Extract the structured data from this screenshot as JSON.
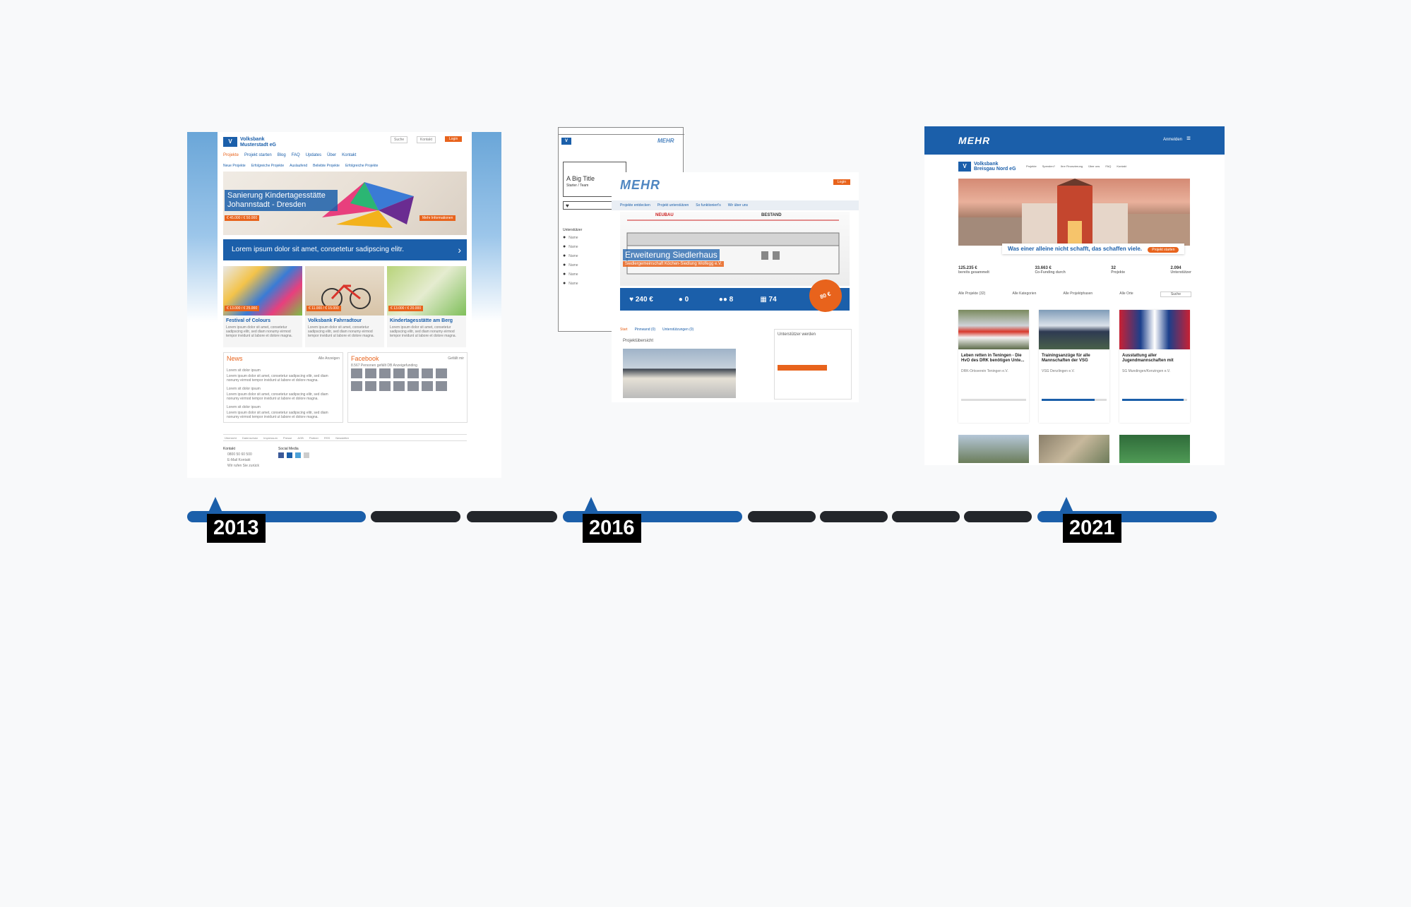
{
  "timeline": {
    "years": [
      "2013",
      "2016",
      "2021"
    ]
  },
  "shot2013": {
    "bank_name": "Volksbank",
    "bank_sub": "Musterstadt eG",
    "top_buttons": [
      "Suche",
      "Kontakt",
      "Login"
    ],
    "nav": [
      "Projekte",
      "Projekt starten",
      "Blog",
      "FAQ",
      "Updates",
      "Über",
      "Kontakt"
    ],
    "subnav": [
      "Neue Projekte",
      "Erfolgreiche Projekte",
      "Auslaufend",
      "Beliebte Projekte",
      "Erfolgreiche Projekte"
    ],
    "hero_title": "Sanierung Kindertagesstätte Johannstadt - Dresden",
    "hero_price": "€ 45.000 / € 50.000",
    "hero_btn": "Mehr Informationen",
    "banner": "Lorem ipsum dolor sit amet, consetetur sadipscing elitr.",
    "cards": [
      {
        "price": "€ 13.000 / € 25.000",
        "title": "Festival of Colours"
      },
      {
        "price": "€ 11.000 / € 15.000",
        "title": "Volksbank Fahrradtour"
      },
      {
        "price": "€ 13.000 / € 20.000",
        "title": "Kindertagesstätte am Berg"
      }
    ],
    "card_desc": "Lorem ipsum dolor sit amet, consetetur sadipscing elitr, sed diam nonumy eirmod tempor invidunt ut labore et dolore magna.",
    "news_title": "News",
    "news_link": "Alle Anzeigen",
    "news_items": [
      "Lorem sit dolor ipsum",
      "Lorem sit dolor ipsum",
      "Lorem sit dolor ipsum"
    ],
    "fb_title": "Facebook",
    "fb_like": "Gefällt mir",
    "fb_text": "8.567 Personen gefällt DB Anzeigefunding",
    "footer": [
      "Übersicht",
      "Datenschutz",
      "Impressum",
      "Presse",
      "AGB",
      "Partner",
      "RSS",
      "Newsletter"
    ],
    "contact_title": "Kontakt",
    "contact_items": [
      "0800 50 60 500",
      "E-Mail Kontakt",
      "Wir rufen Sie zurück"
    ],
    "social_title": "Social Media"
  },
  "shot2016": {
    "wire_title": "A Big Title",
    "wire_sub": "Starter / Team",
    "wire_support": "Unterstützer",
    "wire_name": "Name",
    "logo": "MEHR",
    "login": "Login",
    "nav": [
      "Projekte entdecken",
      "Projekt unterstützen",
      "So funktioniert's",
      "Wir über uns"
    ],
    "neubau": "NEUBAU",
    "bestand": "BESTAND",
    "title": "Erweiterung Siedlerhaus",
    "subtitle": "Siedlergemeinschaft Köchen-Siedlung Wolfegg e.V.",
    "stats": [
      {
        "icon": "heart",
        "value": "240 €"
      },
      {
        "icon": "user",
        "value": "0"
      },
      {
        "icon": "users",
        "value": "8"
      },
      {
        "icon": "calendar",
        "value": "74"
      }
    ],
    "stamp": "80 €",
    "tabs": [
      "Start",
      "Pinnwand (0)",
      "Unterstützungen (0)"
    ],
    "overview": "Projektübersicht",
    "support_title": "Unterstützer werden"
  },
  "shot2021": {
    "logo": "MEHR",
    "login": "Anmelden",
    "bank_name": "Volksbank",
    "bank_sub": "Breisgau Nord eG",
    "nav": [
      "Projekte",
      "Spenden?",
      "Ihre Finanzierung",
      "Über uns",
      "FAQ",
      "Kontakt"
    ],
    "slogan": "Was einer alleine nicht schafft, das schaffen viele.",
    "slogan_btn": "Projekt starten",
    "stats": [
      {
        "value": "125.235 €",
        "label": "bereits gesammelt"
      },
      {
        "value": "33.663 €",
        "label": "Co-Funding durch"
      },
      {
        "value": "32",
        "label": "Projekte"
      },
      {
        "value": "2.094",
        "label": "Unterstützer"
      }
    ],
    "filters": [
      "Alle Projekte (32)",
      "Alle Kategorien",
      "Alle Projektphasen",
      "Alle Orte",
      "Suche"
    ],
    "cards": [
      {
        "title": "Leben retten in Teningen - Die HvO des DRK benötigen Unte...",
        "org": "DRK-Ortsverein Teningen e.V.",
        "progress": 0.0
      },
      {
        "title": "Trainingsanzüge für alle Mannschaften der VSG",
        "org": "VSG Denzlingen e.V.",
        "progress": 0.82
      },
      {
        "title": "Ausstattung aller Jugendmannschaften mit",
        "org": "SG Mundingen/Kenzingen e.V.",
        "progress": 0.95
      }
    ]
  }
}
